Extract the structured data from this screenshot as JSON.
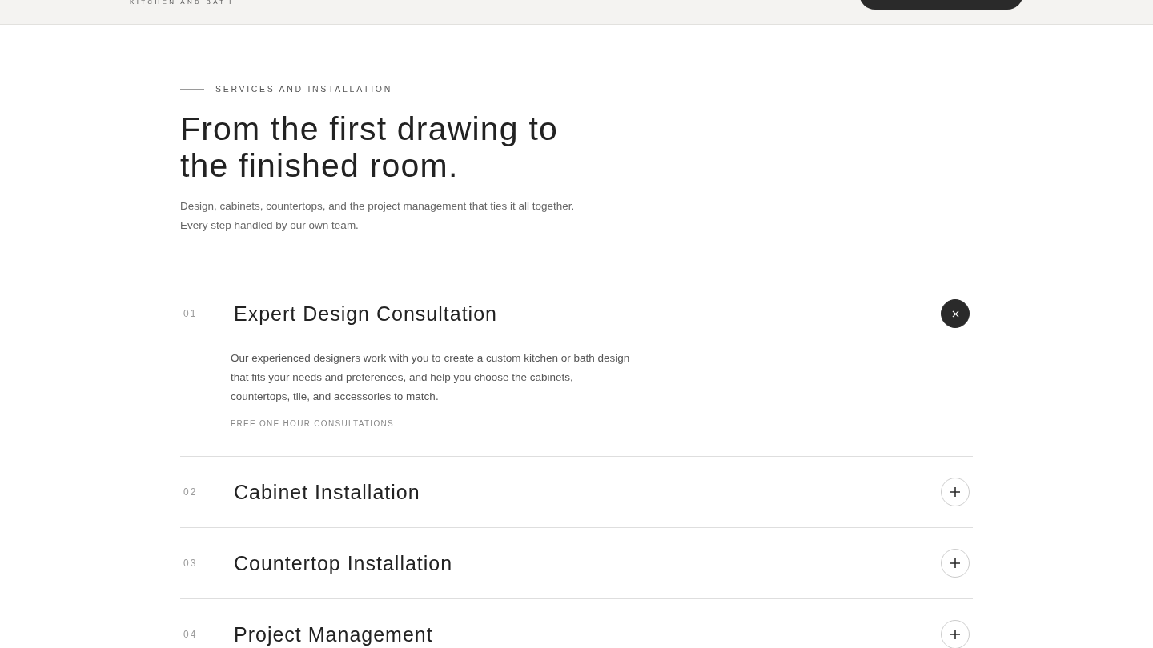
{
  "header": {
    "tagline": "KITCHEN AND BATH"
  },
  "intro": {
    "eyebrow": "SERVICES AND INSTALLATION",
    "title": "From the first drawing to the finished room.",
    "description": "Design, cabinets, countertops, and the project management that ties it all together. Every step handled by our own team."
  },
  "services": [
    {
      "number": "01",
      "title": "Expert Design Consultation",
      "expanded": true,
      "description": "Our experienced designers work with you to create a custom kitchen or bath design that fits your needs and preferences, and help you choose the cabinets, countertops, tile, and accessories to match.",
      "note": "FREE ONE HOUR CONSULTATIONS"
    },
    {
      "number": "02",
      "title": "Cabinet Installation",
      "expanded": false
    },
    {
      "number": "03",
      "title": "Countertop Installation",
      "expanded": false
    },
    {
      "number": "04",
      "title": "Project Management",
      "expanded": false
    }
  ]
}
